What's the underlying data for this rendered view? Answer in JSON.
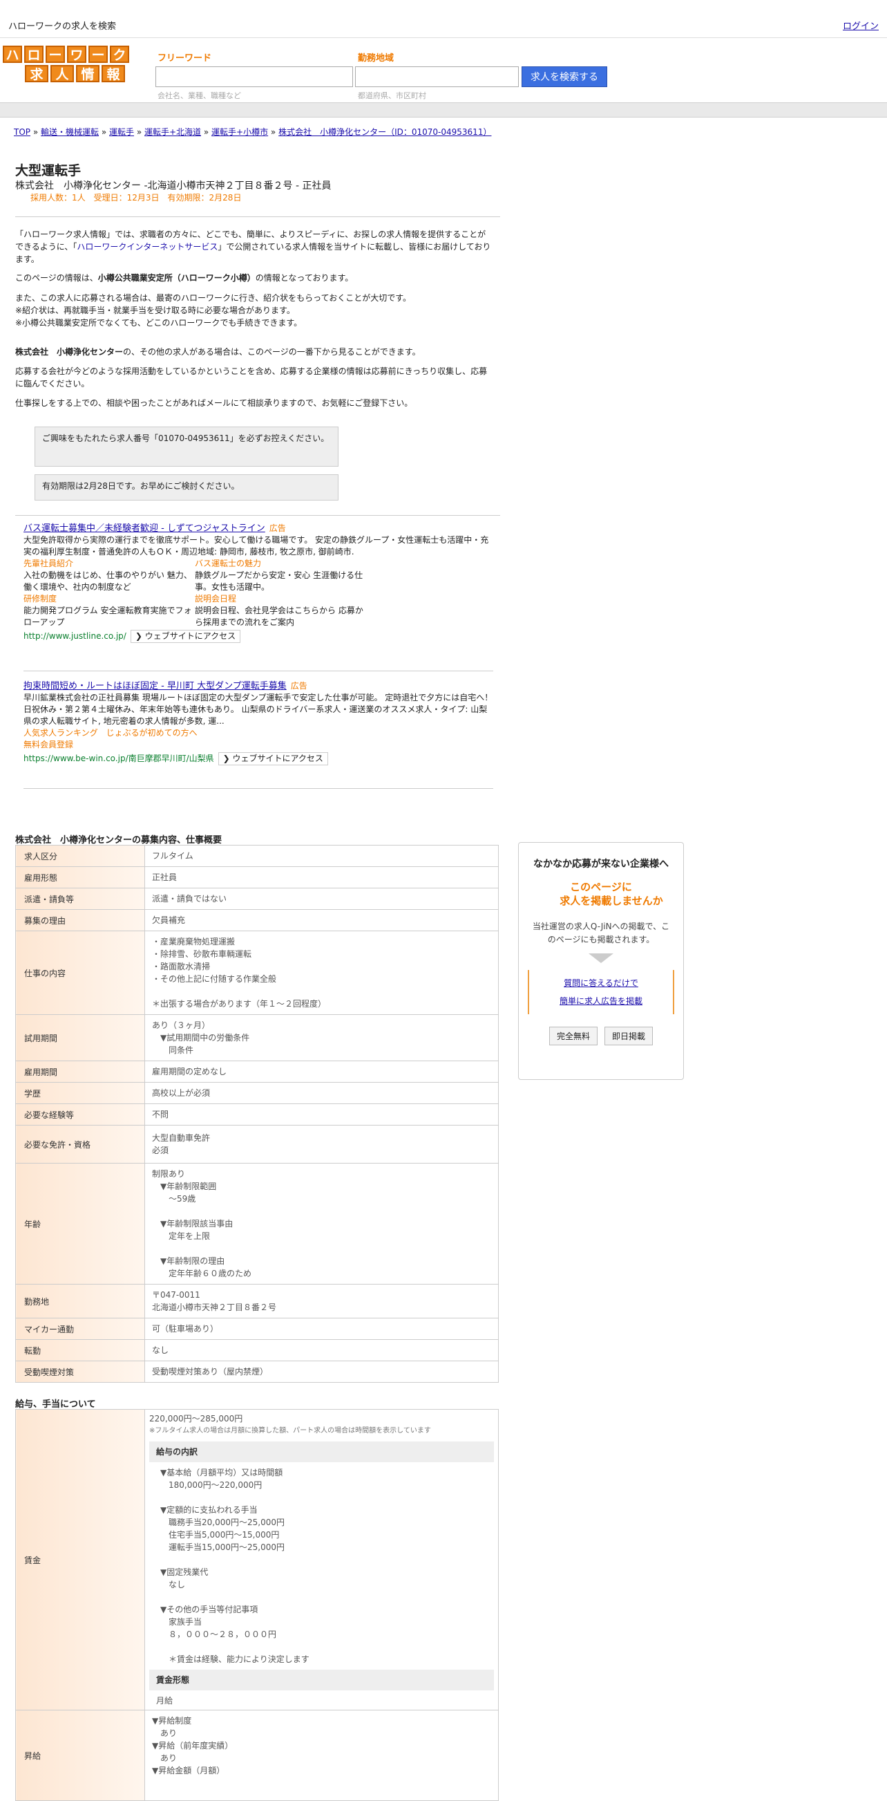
{
  "header": {
    "site_title": "ハローワークの求人を検索",
    "login": "ログイン"
  },
  "logo": {
    "row1": [
      "ハ",
      "ロ",
      "ー",
      "ワ",
      "ー",
      "ク"
    ],
    "row2": [
      "求",
      "人",
      "情",
      "報"
    ]
  },
  "search": {
    "keyword_label": "フリーワード",
    "keyword_hint": "会社名、業種、職種など",
    "area_label": "勤務地域",
    "area_hint": "都道府県、市区町村",
    "button": "求人を検索する"
  },
  "breadcrumb": {
    "items": [
      "TOP",
      "輸送・機械運転",
      "運転手",
      "運転手+北海道",
      "運転手+小樽市",
      "株式会社　小樽浄化センター（ID：01070-04953611）"
    ],
    "sep": " » "
  },
  "job": {
    "title": "大型運転手",
    "subtitle": "株式会社　小樽浄化センター -北海道小樽市天神２丁目８番２号 - 正社員",
    "meta": "採用人数：1人　受理日：12月3日　有効期限：2月28日"
  },
  "intro": {
    "p1a": "「ハローワーク求人情報」では、求職者の方々に、どこでも、簡単に、よりスピーディに、お探しの求人情報を提供することができるように、「",
    "p1link": "ハローワークインターネットサービス",
    "p1b": "」で公開されている求人情報を当サイトに転載し、皆様にお届けしております。",
    "p2a": "このページの情報は、",
    "p2b": "小樽公共職業安定所（ハローワーク小樽）",
    "p2c": "の情報となっております。",
    "p3": "また、この求人に応募される場合は、最寄のハローワークに行き、紹介状をもらっておくことが大切です。",
    "p4": "※紹介状は、再就職手当・就業手当を受け取る時に必要な場合があります。",
    "p5": "※小樽公共職業安定所でなくても、どこのハローワークでも手続きできます。",
    "p6a": "株式会社　小樽浄化センター",
    "p6b": "の、その他の求人がある場合は、このページの一番下から見ることができます。",
    "p7": "応募する会社が今どのような採用活動をしているかということを含め、応募する企業様の情報は応募前にきっちり収集し、応募に臨んでください。",
    "p8": "仕事探しをする上での、相談や困ったことがあればメールにて相談承りますので、お気軽にご登録下さい。"
  },
  "notices": {
    "n1": "ご興味をもたれたら求人番号「01070-04953611」を必ずお控えください。",
    "n2": "有効期限は2月28日です。お早めにご検討ください。"
  },
  "ads": [
    {
      "title": "バス運転士募集中／未経験者歓迎 - しずてつジャストライン",
      "tag": "広告",
      "body": "大型免許取得から実際の運行までを徹底サポート。安心して働ける職場です。 安定の静鉄グループ・女性運転士も活躍中・充実の福利厚生制度・普通免許の人もＯＫ・周辺地域: 静岡市, 藤枝市, 牧之原市, 御前崎市.",
      "sub1_t": "先輩社員紹介",
      "sub1_b": "入社の動機をはじめ、仕事のやりがい 魅力、働く環境や、社内の制度など",
      "sub2_t": "バス運転士の魅力",
      "sub2_b": "静鉄グループだから安定・安心 生涯働ける仕事。女性も活躍中。",
      "sub3_t": "研修制度",
      "sub3_b": "能力開発プログラム 安全運転教育実施でフォローアップ",
      "sub4_t": "説明会日程",
      "sub4_b": "説明会日程、会社見学会はこちらから 応募から採用までの流れをご案内",
      "url": "http://www.justline.co.jp/",
      "web": "❯ ウェブサイトにアクセス"
    },
    {
      "title": "拘束時間短め・ルートはほぼ固定 - 早川町 大型ダンプ運転手募集",
      "tag": "広告",
      "body": "早川鉱業株式会社の正社員募集 現場ルートほぼ固定の大型ダンプ運転手で安定した仕事が可能。 定時退社で夕方には自宅へ！日祝休み・第２第４土曜休み、年末年始等も連休もあり。 山梨県のドライバー系求人・運送業のオススメ求人・タイプ: 山梨県の求人転職サイト, 地元密着の求人情報が多数, 運...",
      "sub1_t": "人気求人ランキング",
      "sub2_t": "じょぶるが初めての方へ",
      "sub3_t": "無料会員登録",
      "url": "https://www.be-win.co.jp/南巨摩郡早川町/山梨県",
      "web": "❯ ウェブサイトにアクセス"
    }
  ],
  "details": {
    "section_title": "株式会社　小樽浄化センターの募集内容、仕事概要",
    "rows": [
      {
        "k": "求人区分",
        "v": "フルタイム"
      },
      {
        "k": "雇用形態",
        "v": "正社員"
      },
      {
        "k": "派遣・請負等",
        "v": "派遣・請負ではない"
      },
      {
        "k": "募集の理由",
        "v": "欠員補充"
      },
      {
        "k": "仕事の内容",
        "v": "・産業廃棄物処理運搬\n・除排雪、砂散布車輌運転\n・路面散水清掃\n・その他上記に付随する作業全般\n\n＊出張する場合があります（年１～２回程度）"
      },
      {
        "k": "試用期間",
        "v": "あり（３ヶ月）\n　▼試用期間中の労働条件\n　　同条件"
      },
      {
        "k": "雇用期間",
        "v": "雇用期間の定めなし"
      },
      {
        "k": "学歴",
        "v": "高校以上が必須"
      },
      {
        "k": "必要な経験等",
        "v": "不問"
      },
      {
        "k": "必要な免許・資格",
        "v": "大型自動車免許\n必須"
      },
      {
        "k": "年齢",
        "v": "制限あり\n　▼年齢制限範囲\n　　〜59歳\n\n　▼年齢制限該当事由\n　　定年を上限\n\n　▼年齢制限の理由\n　　定年年齢６０歳のため"
      },
      {
        "k": "勤務地",
        "v": "〒047-0011\n北海道小樽市天神２丁目８番２号"
      },
      {
        "k": "マイカー通勤",
        "v": "可（駐車場あり）"
      },
      {
        "k": "転勤",
        "v": "なし"
      },
      {
        "k": "受動喫煙対策",
        "v": "受動喫煙対策あり（屋内禁煙）"
      }
    ]
  },
  "salary": {
    "section_title": "給与、手当について",
    "wage_label": "賃金",
    "range": "220,000円〜285,000円",
    "note": "※フルタイム求人の場合は月額に換算した額、パート求人の場合は時間額を表示しています",
    "breakdown_head": "給与の内訳",
    "breakdown": "▼基本給（月額平均）又は時間額\n　180,000円〜220,000円\n\n▼定額的に支払われる手当\n　職務手当20,000円〜25,000円\n　住宅手当5,000円〜15,000円\n　運転手当15,000円〜25,000円\n\n▼固定残業代\n　なし\n\n▼その他の手当等付記事項\n　家族手当\n　８，０００～２８，０００円\n\n　＊賃金は経験、能力により決定します",
    "form_head": "賃金形態",
    "form": "月給",
    "raise_label": "昇給",
    "raise": "▼昇給制度\n　あり\n▼昇給（前年度実績）\n　あり\n▼昇給金額（月額）"
  },
  "sidebar": {
    "head": "なかなか応募が来ない企業様へ",
    "orange1": "このページに",
    "orange2": "求人を掲載しませんか",
    "desc": "当社運営の求人Q-JiNへの掲載で、このページにも掲載されます。",
    "link1": "質問に答えるだけで",
    "link2": "簡単に求人広告を掲載",
    "btn1": "完全無料",
    "btn2": "即日掲載"
  }
}
